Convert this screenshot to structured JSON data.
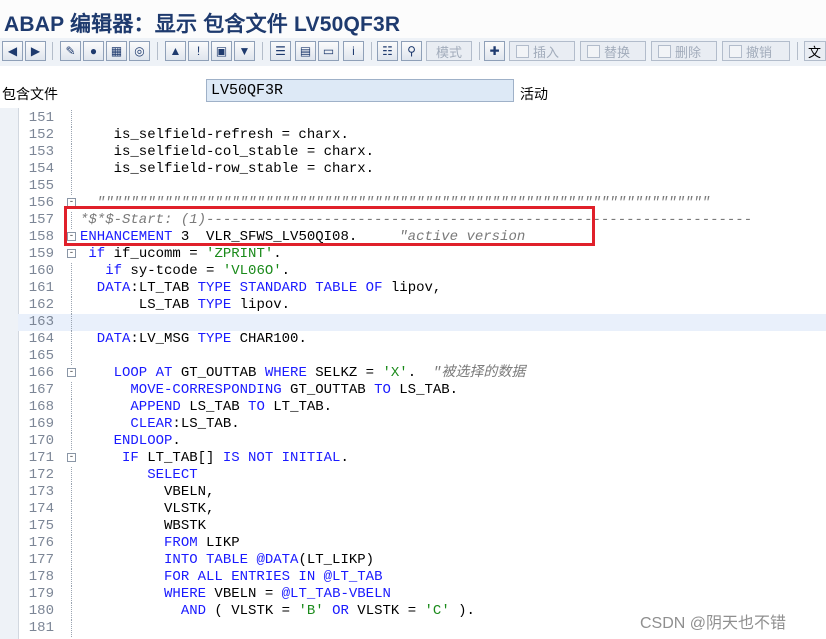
{
  "window": {
    "title": "ABAP 编辑器：显示 包含文件 LV50QF3R"
  },
  "toolbar": {
    "icons": [
      "arrow-left-icon",
      "arrow-right-icon",
      "pencil-check-icon",
      "balls-icon",
      "object-list-icon",
      "target-icon",
      "tree-icon",
      "info-marker-icon",
      "screen-icon",
      "hierarchy-icon",
      "stack-icon",
      "table-icon",
      "window-icon",
      "info-icon",
      "print-preview-icon",
      "find-icon",
      "insert-node-icon",
      "block-icon",
      "replace-block-icon",
      "delete-block-icon",
      "undo-block-icon"
    ],
    "mode_label": "模式",
    "insert_label": "插入",
    "replace_label": "替换",
    "delete_label": "删除",
    "undo_label": "撤销",
    "doc_label": "文"
  },
  "include": {
    "label": "包含文件",
    "value": "LV50QF3R",
    "status": "活动"
  },
  "editor": {
    "lines": [
      {
        "num": "151",
        "tokens": [
          {
            "t": "",
            "c": "txt"
          }
        ]
      },
      {
        "num": "152",
        "tokens": [
          {
            "t": "    is_selfield-refresh = charx.",
            "c": "txt"
          }
        ]
      },
      {
        "num": "153",
        "tokens": [
          {
            "t": "    is_selfield-col_stable = charx.",
            "c": "txt"
          }
        ]
      },
      {
        "num": "154",
        "tokens": [
          {
            "t": "    is_selfield-row_stable = charx.",
            "c": "txt"
          }
        ]
      },
      {
        "num": "155",
        "tokens": [
          {
            "t": "",
            "c": "txt"
          }
        ]
      },
      {
        "num": "156",
        "fold": "-",
        "tokens": [
          {
            "t": "  \"\"\"\"\"\"\"\"\"\"\"\"\"\"\"\"\"\"\"\"\"\"\"\"\"\"\"\"\"\"\"\"\"\"\"\"\"\"\"\"\"\"\"\"\"\"\"\"\"\"\"\"\"\"\"\"\"\"\"\"\"\"\"\"\"\"\"\"\"\"\"\"\"",
            "c": "cmt"
          }
        ]
      },
      {
        "num": "157",
        "tokens": [
          {
            "t": "*$*$-Start: (1)-----------------------------------------------------------------",
            "c": "cmt"
          }
        ]
      },
      {
        "num": "158",
        "fold": "-",
        "tokens": [
          {
            "t": "ENHANCEMENT",
            "c": "kw"
          },
          {
            "t": " 3  VLR_SFWS_LV50QI08.     ",
            "c": "txt"
          },
          {
            "t": "\"active version",
            "c": "cmt"
          }
        ]
      },
      {
        "num": "159",
        "fold": "-",
        "tokens": [
          {
            "t": " if",
            "c": "kw"
          },
          {
            "t": " if_ucomm = ",
            "c": "txt"
          },
          {
            "t": "'ZPRINT'",
            "c": "str"
          },
          {
            "t": ".",
            "c": "txt"
          }
        ]
      },
      {
        "num": "160",
        "tokens": [
          {
            "t": "   if",
            "c": "kw"
          },
          {
            "t": " sy-tcode = ",
            "c": "txt"
          },
          {
            "t": "'VL06O'",
            "c": "str"
          },
          {
            "t": ".",
            "c": "txt"
          }
        ]
      },
      {
        "num": "161",
        "tokens": [
          {
            "t": "  DATA",
            "c": "kw"
          },
          {
            "t": ":LT_TAB ",
            "c": "txt"
          },
          {
            "t": "TYPE STANDARD TABLE OF",
            "c": "kw"
          },
          {
            "t": " lipov,",
            "c": "txt"
          }
        ]
      },
      {
        "num": "162",
        "tokens": [
          {
            "t": "       LS_TAB ",
            "c": "txt"
          },
          {
            "t": "TYPE",
            "c": "kw"
          },
          {
            "t": " lipov.",
            "c": "txt"
          }
        ]
      },
      {
        "num": "163",
        "hl": true,
        "tokens": [
          {
            "t": "",
            "c": "txt"
          }
        ]
      },
      {
        "num": "164",
        "tokens": [
          {
            "t": "  DATA",
            "c": "kw"
          },
          {
            "t": ":LV_MSG ",
            "c": "txt"
          },
          {
            "t": "TYPE",
            "c": "kw"
          },
          {
            "t": " CHAR100.",
            "c": "txt"
          }
        ]
      },
      {
        "num": "165",
        "tokens": [
          {
            "t": "",
            "c": "txt"
          }
        ]
      },
      {
        "num": "166",
        "fold": "-",
        "tokens": [
          {
            "t": "    LOOP AT",
            "c": "kw"
          },
          {
            "t": " GT_OUTTAB ",
            "c": "txt"
          },
          {
            "t": "WHERE",
            "c": "kw"
          },
          {
            "t": " SELKZ = ",
            "c": "txt"
          },
          {
            "t": "'X'",
            "c": "str"
          },
          {
            "t": ".  ",
            "c": "txt"
          },
          {
            "t": "\"被选择的数据",
            "c": "cmt"
          }
        ]
      },
      {
        "num": "167",
        "tokens": [
          {
            "t": "      MOVE-CORRESPONDING",
            "c": "kw"
          },
          {
            "t": " GT_OUTTAB ",
            "c": "txt"
          },
          {
            "t": "TO",
            "c": "kw"
          },
          {
            "t": " LS_TAB.",
            "c": "txt"
          }
        ]
      },
      {
        "num": "168",
        "tokens": [
          {
            "t": "      APPEND",
            "c": "kw"
          },
          {
            "t": " LS_TAB ",
            "c": "txt"
          },
          {
            "t": "TO",
            "c": "kw"
          },
          {
            "t": " LT_TAB.",
            "c": "txt"
          }
        ]
      },
      {
        "num": "169",
        "tokens": [
          {
            "t": "      CLEAR",
            "c": "kw"
          },
          {
            "t": ":LS_TAB.",
            "c": "txt"
          }
        ]
      },
      {
        "num": "170",
        "tokens": [
          {
            "t": "    ENDLOOP",
            "c": "kw"
          },
          {
            "t": ".",
            "c": "txt"
          }
        ]
      },
      {
        "num": "171",
        "fold": "-",
        "tokens": [
          {
            "t": "     IF",
            "c": "kw"
          },
          {
            "t": " LT_TAB[] ",
            "c": "txt"
          },
          {
            "t": "IS NOT INITIAL",
            "c": "kw"
          },
          {
            "t": ".",
            "c": "txt"
          }
        ]
      },
      {
        "num": "172",
        "tokens": [
          {
            "t": "        SELECT",
            "c": "kw"
          }
        ]
      },
      {
        "num": "173",
        "tokens": [
          {
            "t": "          VBELN,",
            "c": "txt"
          }
        ]
      },
      {
        "num": "174",
        "tokens": [
          {
            "t": "          VLSTK,",
            "c": "txt"
          }
        ]
      },
      {
        "num": "175",
        "tokens": [
          {
            "t": "          WBSTK",
            "c": "txt"
          }
        ]
      },
      {
        "num": "176",
        "tokens": [
          {
            "t": "          FROM",
            "c": "kw"
          },
          {
            "t": " LIKP",
            "c": "txt"
          }
        ]
      },
      {
        "num": "177",
        "tokens": [
          {
            "t": "          INTO TABLE",
            "c": "kw"
          },
          {
            "t": " ",
            "c": "txt"
          },
          {
            "t": "@DATA",
            "c": "kw"
          },
          {
            "t": "(LT_LIKP)",
            "c": "txt"
          }
        ]
      },
      {
        "num": "178",
        "tokens": [
          {
            "t": "          FOR ALL ENTRIES IN",
            "c": "kw"
          },
          {
            "t": " ",
            "c": "txt"
          },
          {
            "t": "@LT_TAB",
            "c": "kw"
          }
        ]
      },
      {
        "num": "179",
        "tokens": [
          {
            "t": "          WHERE",
            "c": "kw"
          },
          {
            "t": " VBELN = ",
            "c": "txt"
          },
          {
            "t": "@LT_TAB-VBELN",
            "c": "kw"
          }
        ]
      },
      {
        "num": "180",
        "tokens": [
          {
            "t": "            AND",
            "c": "kw"
          },
          {
            "t": " ( VLSTK = ",
            "c": "txt"
          },
          {
            "t": "'B'",
            "c": "str"
          },
          {
            "t": " ",
            "c": "txt"
          },
          {
            "t": "OR",
            "c": "kw"
          },
          {
            "t": " VLSTK = ",
            "c": "txt"
          },
          {
            "t": "'C'",
            "c": "str"
          },
          {
            "t": " ).",
            "c": "txt"
          }
        ]
      },
      {
        "num": "181",
        "tokens": [
          {
            "t": "",
            "c": "txt"
          }
        ]
      }
    ]
  },
  "watermark": "CSDN @阴天也不错",
  "colors": {
    "keyword": "#1a1aff",
    "string": "#1a8a1a",
    "comment": "#7a7a7a",
    "highlight_box": "#e0202a",
    "title": "#1e3a6e"
  }
}
